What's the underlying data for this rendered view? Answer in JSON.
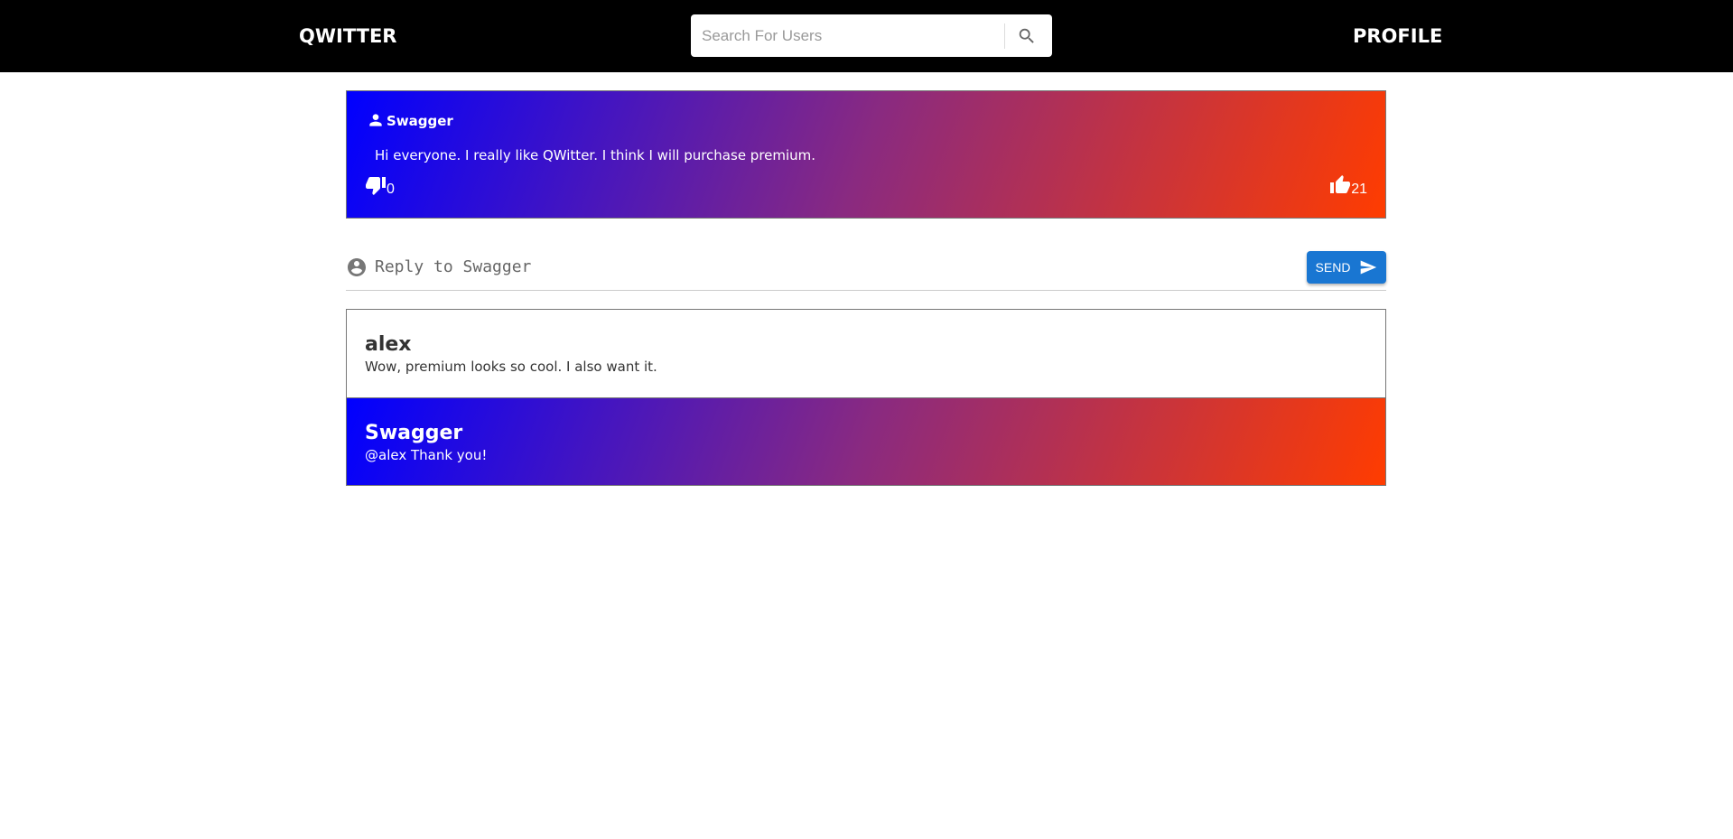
{
  "header": {
    "brand": "QWITTER",
    "profile": "PROFILE",
    "search_placeholder": "Search For Users"
  },
  "post": {
    "author": "Swagger",
    "text": "Hi everyone. I really like QWitter. I think I will purchase premium.",
    "dislikes": "0",
    "likes": "21"
  },
  "reply": {
    "placeholder": "Reply to Swagger",
    "send_label": "SEND"
  },
  "comments": [
    {
      "author": "alex",
      "text": "Wow, premium looks so cool. I also want it.",
      "premium": false
    },
    {
      "author": "Swagger",
      "text": "@alex Thank you!",
      "premium": true
    }
  ],
  "colors": {
    "gradient_start": "#0000ff",
    "gradient_end": "#ff3c00",
    "send": "#1976d2"
  }
}
